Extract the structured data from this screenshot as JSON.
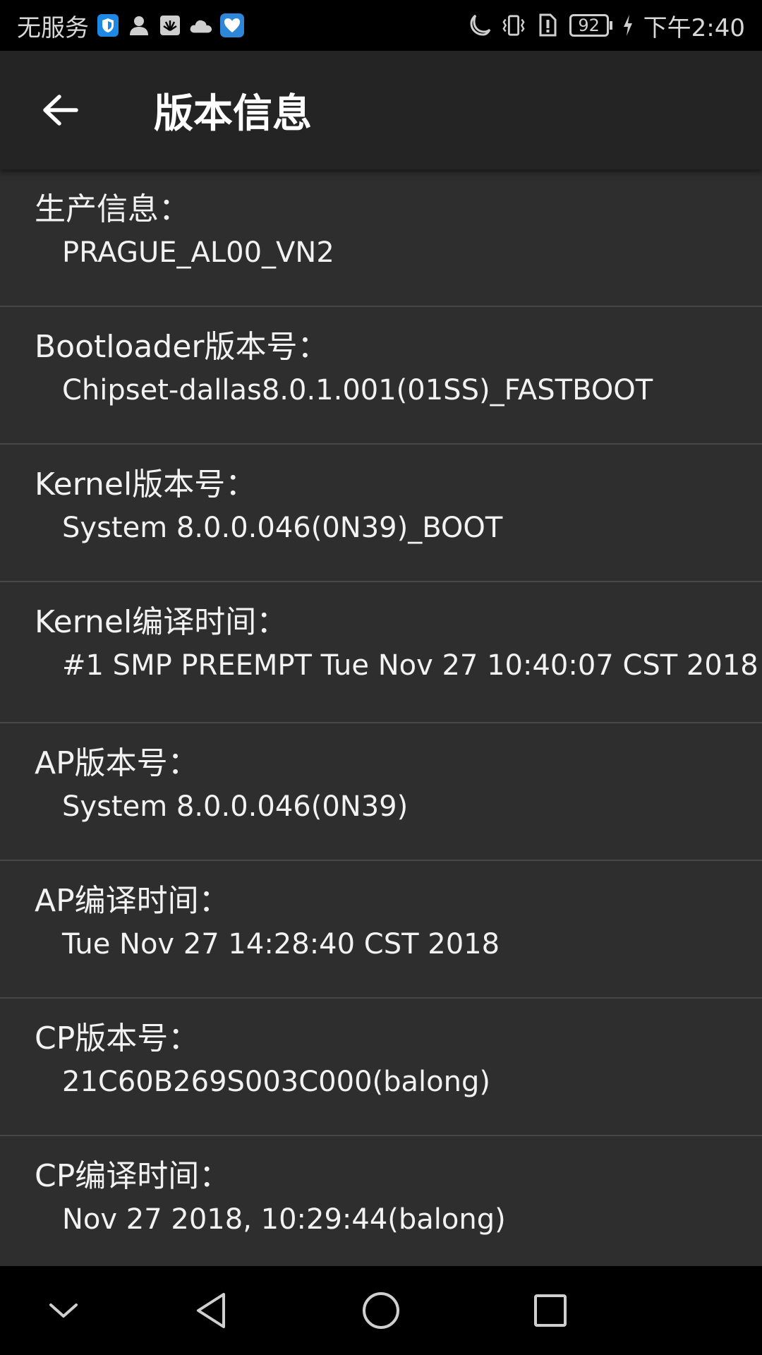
{
  "status_bar": {
    "carrier": "无服务",
    "battery": "92",
    "time": "下午2:40",
    "icons": [
      "shield-icon",
      "person-icon",
      "huawei-icon",
      "cloud-icon",
      "heart-app-icon",
      "moon-icon",
      "vibrate-icon",
      "alert-icon",
      "battery-icon",
      "charging-icon"
    ]
  },
  "app_bar": {
    "title": "版本信息",
    "back_icon": "back-arrow-icon"
  },
  "items": [
    {
      "label": "生产信息：",
      "value": "PRAGUE_AL00_VN2"
    },
    {
      "label": "Bootloader版本号：",
      "value": "Chipset-dallas8.0.1.001(01SS)_FASTBOOT"
    },
    {
      "label": "Kernel版本号：",
      "value": "System 8.0.0.046(0N39)_BOOT"
    },
    {
      "label": "Kernel编译时间：",
      "value": "#1 SMP PREEMPT Tue Nov 27 10:40:07 CST 2018"
    },
    {
      "label": "AP版本号：",
      "value": "System 8.0.0.046(0N39)"
    },
    {
      "label": "AP编译时间：",
      "value": "Tue Nov 27 14:28:40 CST 2018"
    },
    {
      "label": "CP版本号：",
      "value": "21C60B269S003C000(balong)"
    },
    {
      "label": "CP编译时间：",
      "value": "Nov 27 2018, 10:29:44(balong)"
    }
  ],
  "nav_bar": {
    "buttons": [
      "collapse-icon",
      "back-triangle-icon",
      "home-circle-icon",
      "recents-square-icon"
    ]
  }
}
